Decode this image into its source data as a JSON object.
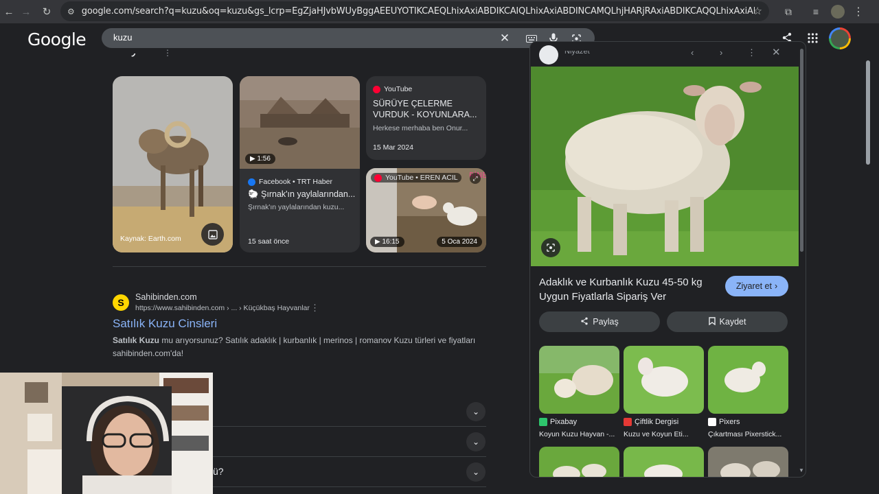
{
  "browser": {
    "url": "google.com/search?q=kuzu&oq=kuzu&gs_lcrp=EgZjaHJvbWUyBggAEEUYOTIKCAEQLhixAxiABDIKCAIQLhixAxiABDINCAMQLhjHARjRAxiABDIKCAQQLhixAxiABDINCAUQLhivARjHARiABDI..."
  },
  "search": {
    "query": "kuzu",
    "logo": "Google"
  },
  "section": {
    "title": "Koyun"
  },
  "cards": {
    "card1": {
      "caption": "Kaynak: Earth.com"
    },
    "card2": {
      "duration": "1:56",
      "source": "Facebook • TRT Haber",
      "title": "🐑 Şırnak'ın yaylalarından...",
      "subtitle": "Şırnak'ın yaylalarından kuzu...",
      "date": "15 saat önce"
    },
    "card3": {
      "source": "YouTube",
      "title": "SÜRÜYE ÇELERME VURDUK - KOYUNLARA...",
      "subtitle": "Herkese merhaba ben Onur...",
      "date": "15 Mar 2024"
    },
    "card4": {
      "source": "YouTube • EREN ACIL",
      "duration": "16:15",
      "date": "5 Oca 2024"
    }
  },
  "result": {
    "favicon": "S",
    "site": "Sahibinden.com",
    "url": "https://www.sahibinden.com › ... › Küçükbaş Hayvanlar",
    "title": "Satılık Kuzu Cinsleri",
    "snippet_bold": "Satılık Kuzu",
    "snippet_rest": " mu arıyorsunuz? Satılık adaklık | kurbanlık | merinos | romanov Kuzu türleri ve fiyatları sahibinden.com'da!"
  },
  "faq": {
    "partial_text": "ü?"
  },
  "panel": {
    "source_partial": "Niyazet",
    "title": "Adaklık ve Kurbanlık Kuzu 45-50 kg Uygun Fiyatlarla Sipariş Ver",
    "visit_label": "Ziyaret et",
    "share_label": "Paylaş",
    "save_label": "Kaydet",
    "related": [
      {
        "source": "Pixabay",
        "caption": "Koyun Kuzu Hayvan -..."
      },
      {
        "source": "Çiftlik Dergisi",
        "caption": "Kuzu ve Koyun Eti..."
      },
      {
        "source": "Pixers",
        "caption": "Çıkartması Pixerstick..."
      }
    ]
  },
  "colors": {
    "accent": "#8ab4f8",
    "background": "#202124"
  }
}
